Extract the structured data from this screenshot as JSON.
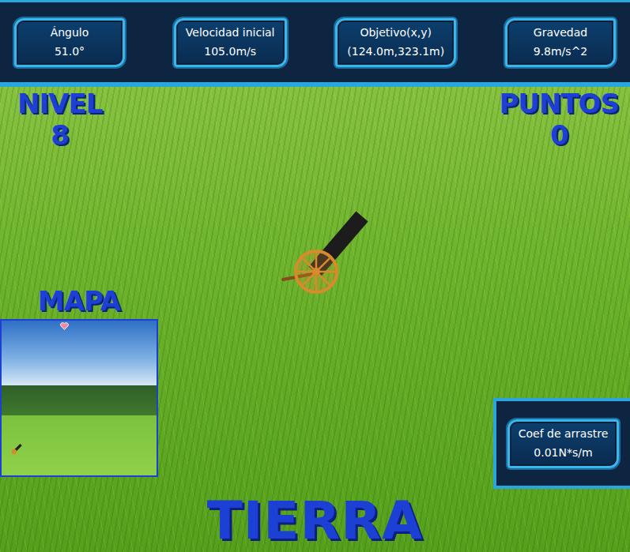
{
  "hud": [
    {
      "label": "Ángulo",
      "value": "51.0°"
    },
    {
      "label": "Velocidad inicial",
      "value": "105.0m/s"
    },
    {
      "label": "Objetivo(x,y)",
      "value": "(124.0m,323.1m)"
    },
    {
      "label": "Gravedad",
      "value": "9.8m/s^2"
    }
  ],
  "level": {
    "label": "NIVEL",
    "value": "8"
  },
  "score": {
    "label": "PUNTOS",
    "value": "0"
  },
  "map": {
    "title": "MAPA"
  },
  "drag": {
    "label": "Coef de arrastre",
    "value": "0.01N*s/m"
  },
  "planet": "TIERRA"
}
